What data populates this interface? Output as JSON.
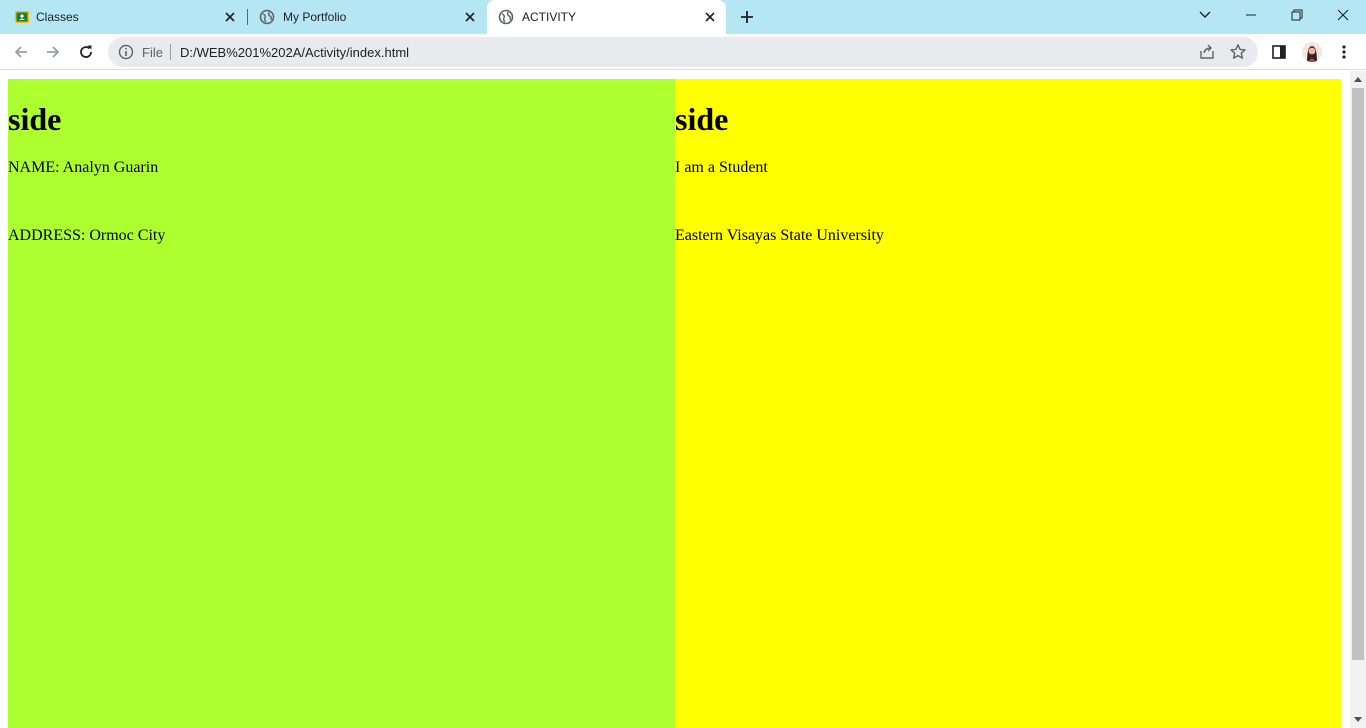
{
  "browser": {
    "tabs": [
      {
        "title": "Classes",
        "icon": "classroom-icon",
        "active": false
      },
      {
        "title": "My Portfolio",
        "icon": "globe-icon",
        "active": false
      },
      {
        "title": "ACTIVITY",
        "icon": "globe-icon",
        "active": true
      }
    ],
    "address_bar": {
      "scheme_label": "File",
      "url": "D:/WEB%201%202A/Activity/index.html"
    },
    "colors": {
      "tabstrip": "#b5e6f3",
      "omnibox": "#e8eaed"
    }
  },
  "page": {
    "left": {
      "heading": "side",
      "line1": "NAME: Analyn Guarin",
      "line2": "ADDRESS: Ormoc City",
      "background": "#adff2f"
    },
    "right": {
      "heading": "side",
      "line1": "I am a Student",
      "line2": "Eastern Visayas State University",
      "background": "#ffff00"
    }
  }
}
